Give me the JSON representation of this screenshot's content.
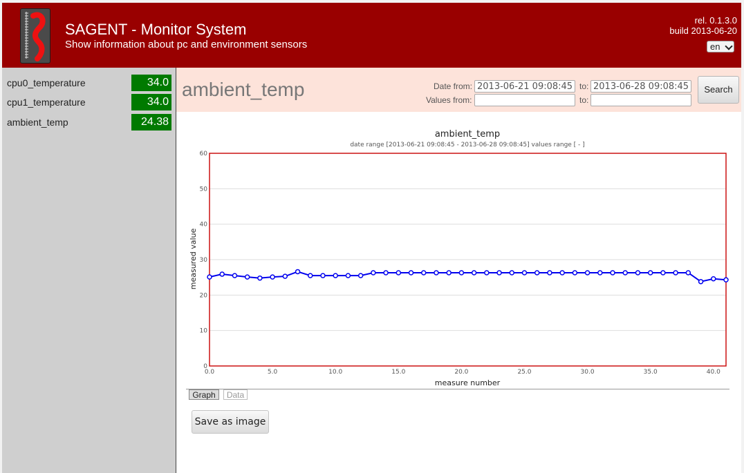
{
  "header": {
    "title": "SAGENT - Monitor System",
    "subtitle": "Show information about pc and environment sensors",
    "release": "rel. 0.1.3.0",
    "build": "build 2013-06-20",
    "language": "en"
  },
  "colors": {
    "header_bg": "#990000",
    "value_badge_bg": "#007a00",
    "search_bar_bg": "#fde3da",
    "series_line": "#0000ee",
    "plot_border": "#cc1111"
  },
  "sidebar": {
    "items": [
      {
        "name": "cpu0_temperature",
        "value": "34.0"
      },
      {
        "name": "cpu1_temperature",
        "value": "34.0"
      },
      {
        "name": "ambient_temp",
        "value": "24.38"
      }
    ]
  },
  "main": {
    "sensor_title": "ambient_temp",
    "form": {
      "date_from_label": "Date from:",
      "date_from_value": "2013-06-21 09:08:45",
      "date_to_label": "to:",
      "date_to_value": "2013-06-28 09:08:45",
      "values_from_label": "Values from:",
      "values_from_value": "",
      "values_to_label": "to:",
      "values_to_value": "",
      "search_label": "Search"
    },
    "tabs": [
      {
        "label": "Graph",
        "active": true
      },
      {
        "label": "Data",
        "active": false
      }
    ],
    "save_label": "Save as image"
  },
  "chart_data": {
    "type": "line",
    "title": "ambient_temp",
    "subtitle": "date range [2013-06-21 09:08:45 - 2013-06-28 09:08:45]  values range [ - ]",
    "xlabel": "measure number",
    "ylabel": "measured value",
    "xlim": [
      0,
      41
    ],
    "ylim": [
      0,
      60
    ],
    "x_ticks": [
      "0.0",
      "5.0",
      "10.0",
      "15.0",
      "20.0",
      "25.0",
      "30.0",
      "35.0",
      "40.0"
    ],
    "y_ticks": [
      "0",
      "10",
      "20",
      "30",
      "40",
      "50",
      "60"
    ],
    "grid": true,
    "series": [
      {
        "x": [
          0,
          1,
          2,
          3,
          4,
          5,
          6,
          7,
          8,
          9,
          10,
          11,
          12,
          13,
          14,
          15,
          16,
          17,
          18,
          19,
          20,
          21,
          22,
          23,
          24,
          25,
          26,
          27,
          28,
          29,
          30,
          31,
          32,
          33,
          34,
          35,
          36,
          37,
          38,
          39,
          40,
          41
        ],
        "values": [
          25.1,
          25.9,
          25.5,
          25.1,
          24.8,
          25.1,
          25.3,
          26.6,
          25.5,
          25.5,
          25.5,
          25.5,
          25.5,
          26.3,
          26.3,
          26.3,
          26.3,
          26.3,
          26.3,
          26.3,
          26.3,
          26.3,
          26.3,
          26.3,
          26.3,
          26.3,
          26.3,
          26.3,
          26.3,
          26.3,
          26.3,
          26.3,
          26.3,
          26.3,
          26.3,
          26.3,
          26.3,
          26.3,
          26.3,
          23.8,
          24.6,
          24.3
        ]
      }
    ]
  }
}
